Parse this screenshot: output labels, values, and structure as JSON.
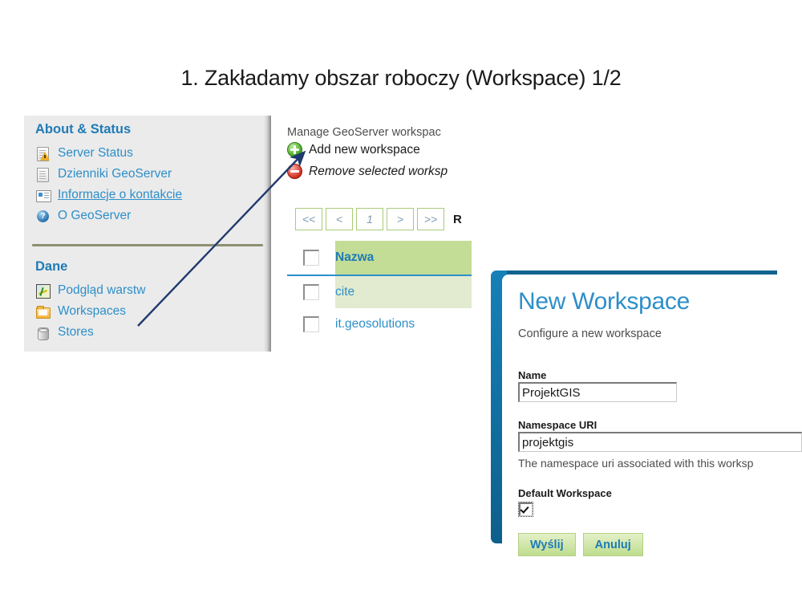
{
  "slide": {
    "title": "1. Zakładamy obszar roboczy (Workspace) 1/2"
  },
  "sidebar": {
    "sections": [
      {
        "heading": "About & Status",
        "items": [
          {
            "label": "Server Status",
            "icon": "server-status-icon"
          },
          {
            "label": "Dzienniki GeoServer",
            "icon": "document-icon"
          },
          {
            "label": "Informacje o kontakcie",
            "icon": "contact-card-icon"
          },
          {
            "label": "O GeoServer",
            "icon": "help-circle-icon"
          }
        ]
      },
      {
        "heading": "Dane",
        "items": [
          {
            "label": "Podgląd warstw",
            "icon": "layer-preview-icon"
          },
          {
            "label": "Workspaces",
            "icon": "folder-icon"
          },
          {
            "label": "Stores",
            "icon": "database-cylinder-icon"
          }
        ]
      }
    ]
  },
  "workspaces_page": {
    "subtitle": "Manage GeoServer workspac",
    "actions": [
      {
        "label": "Add new workspace",
        "icon": "add-circle-icon"
      },
      {
        "label": "Remove selected worksp",
        "icon": "remove-circle-icon"
      }
    ],
    "pager": {
      "first": "<<",
      "prev": "<",
      "current": "1",
      "next": ">",
      "last": ">>",
      "results": "R"
    },
    "table": {
      "columns": [
        "Nazwa"
      ],
      "rows": [
        {
          "name": "cite"
        },
        {
          "name": "it.geosolutions"
        }
      ]
    }
  },
  "dialog": {
    "title": "New Workspace",
    "subtitle": "Configure a new workspace",
    "fields": {
      "name_label": "Name",
      "name_value": "ProjektGIS",
      "namespace_label": "Namespace URI",
      "namespace_value": "projektgis",
      "namespace_hint": "The namespace uri associated with this worksp",
      "default_label": "Default Workspace"
    },
    "buttons": {
      "submit": "Wyślij",
      "cancel": "Anuluj"
    }
  },
  "colors": {
    "accent_blue": "#2d8fc9",
    "dialog_bar": "#10638f",
    "table_header_green": "#c3dc96",
    "table_row_green": "#e2ebd0",
    "button_green": "#bedd8e",
    "arrow_navy": "#1f3a6e"
  }
}
